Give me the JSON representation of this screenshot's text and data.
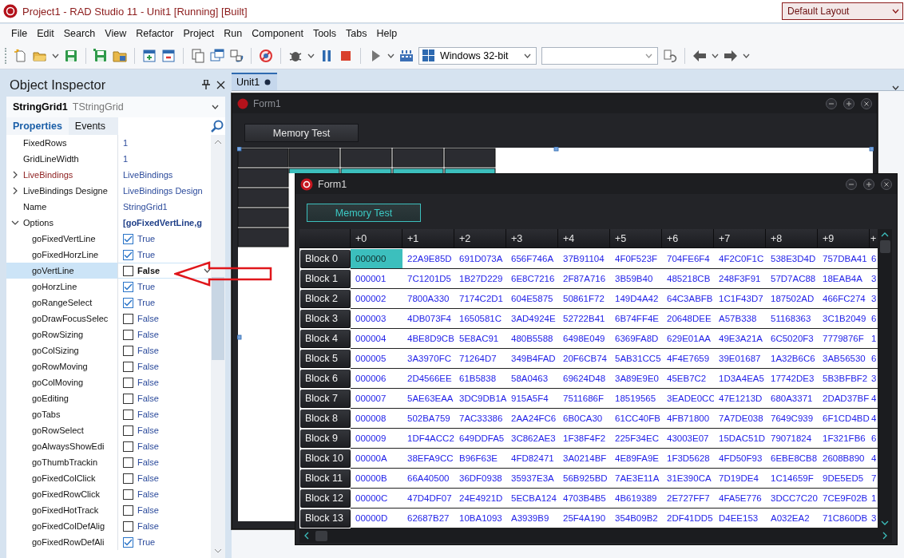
{
  "window": {
    "title": "Project1 - RAD Studio 11 - Unit1 [Running] [Built]",
    "layout": "Default Layout"
  },
  "menu": [
    "File",
    "Edit",
    "Search",
    "View",
    "Refactor",
    "Project",
    "Run",
    "Component",
    "Tools",
    "Tabs",
    "Help"
  ],
  "toolbar": {
    "platform": "Windows 32-bit"
  },
  "inspector": {
    "title": "Object Inspector",
    "component": {
      "name": "StringGrid1",
      "type": "TStringGrid"
    },
    "tabs": [
      {
        "label": "Properties",
        "selected": true
      },
      {
        "label": "Events",
        "selected": false
      }
    ],
    "properties": [
      {
        "name": "FixedRows",
        "value": "1",
        "kind": "plain",
        "selected": false
      },
      {
        "name": "GridLineWidth",
        "value": "1",
        "kind": "plain",
        "selected": false
      },
      {
        "name": "LiveBindings",
        "value": "LiveBindings",
        "kind": "binding",
        "expanded": false,
        "selected": false
      },
      {
        "name": "LiveBindings Designe",
        "value": "LiveBindings Design",
        "kind": "plain",
        "expanded": false,
        "selected": false
      },
      {
        "name": "Name",
        "value": "StringGrid1",
        "kind": "plain",
        "selected": false
      },
      {
        "name": "Options",
        "value": "[goFixedVertLine,g",
        "kind": "set",
        "expanded": true,
        "selected": false,
        "children": [
          {
            "name": "goFixedVertLine",
            "value": "True",
            "kind": "flag",
            "checked": true,
            "selected": false
          },
          {
            "name": "goFixedHorzLine",
            "value": "True",
            "kind": "flag",
            "checked": true,
            "selected": false
          },
          {
            "name": "goVertLine",
            "value": "False",
            "kind": "flag",
            "checked": false,
            "selected": true
          },
          {
            "name": "goHorzLine",
            "value": "True",
            "kind": "flag",
            "checked": true,
            "selected": false
          },
          {
            "name": "goRangeSelect",
            "value": "True",
            "kind": "flag",
            "checked": true,
            "selected": false
          },
          {
            "name": "goDrawFocusSelec",
            "value": "False",
            "kind": "flag",
            "checked": false,
            "selected": false
          },
          {
            "name": "goRowSizing",
            "value": "False",
            "kind": "flag",
            "checked": false,
            "selected": false
          },
          {
            "name": "goColSizing",
            "value": "False",
            "kind": "flag",
            "checked": false,
            "selected": false
          },
          {
            "name": "goRowMoving",
            "value": "False",
            "kind": "flag",
            "checked": false,
            "selected": false
          },
          {
            "name": "goColMoving",
            "value": "False",
            "kind": "flag",
            "checked": false,
            "selected": false
          },
          {
            "name": "goEditing",
            "value": "False",
            "kind": "flag",
            "checked": false,
            "selected": false
          },
          {
            "name": "goTabs",
            "value": "False",
            "kind": "flag",
            "checked": false,
            "selected": false
          },
          {
            "name": "goRowSelect",
            "value": "False",
            "kind": "flag",
            "checked": false,
            "selected": false
          },
          {
            "name": "goAlwaysShowEdi",
            "value": "False",
            "kind": "flag",
            "checked": false,
            "selected": false
          },
          {
            "name": "goThumbTrackin",
            "value": "False",
            "kind": "flag",
            "checked": false,
            "selected": false
          },
          {
            "name": "goFixedColClick",
            "value": "False",
            "kind": "flag",
            "checked": false,
            "selected": false
          },
          {
            "name": "goFixedRowClick",
            "value": "False",
            "kind": "flag",
            "checked": false,
            "selected": false
          },
          {
            "name": "goFixedHotTrack",
            "value": "False",
            "kind": "flag",
            "checked": false,
            "selected": false
          },
          {
            "name": "goFixedColDefAlig",
            "value": "False",
            "kind": "flag",
            "checked": false,
            "selected": false
          },
          {
            "name": "goFixedRowDefAli",
            "value": "True",
            "kind": "flag",
            "checked": true,
            "selected": false
          }
        ]
      }
    ]
  },
  "editor_tab": {
    "label": "Unit1",
    "modified": true
  },
  "design_form": {
    "title": "Form1",
    "button": "Memory Test"
  },
  "form": {
    "title": "Form1",
    "button": "Memory Test",
    "grid": {
      "columns": [
        "+0",
        "+1",
        "+2",
        "+3",
        "+4",
        "+5",
        "+6",
        "+7",
        "+8",
        "+9",
        "+"
      ],
      "rows": [
        {
          "header": "Block 0",
          "cells": [
            {
              "text": "000000",
              "selected": true
            },
            {
              "text": "22A9E85D",
              "selected": false
            },
            {
              "text": "691D073A",
              "selected": false
            },
            {
              "text": "656F746A",
              "selected": false
            },
            {
              "text": "37B91104",
              "selected": false
            },
            {
              "text": "4F0F523F",
              "selected": false
            },
            {
              "text": "704FE6F4",
              "selected": false
            },
            {
              "text": "4F2C0F1C",
              "selected": false
            },
            {
              "text": "538E3D4D",
              "selected": false
            },
            {
              "text": "757DBA41",
              "selected": false
            },
            {
              "text": "6",
              "selected": false
            }
          ]
        },
        {
          "header": "Block 1",
          "cells": [
            {
              "text": "000001",
              "selected": false
            },
            {
              "text": "7C1201D5",
              "selected": false
            },
            {
              "text": "1B27D229",
              "selected": false
            },
            {
              "text": "6E8C7216",
              "selected": false
            },
            {
              "text": "2F87A716",
              "selected": false
            },
            {
              "text": "3B59B40",
              "selected": false
            },
            {
              "text": "485218CB",
              "selected": false
            },
            {
              "text": "248F3F91",
              "selected": false
            },
            {
              "text": "57D7AC88",
              "selected": false
            },
            {
              "text": "18EAB4A",
              "selected": false
            },
            {
              "text": "3",
              "selected": false
            }
          ]
        },
        {
          "header": "Block 2",
          "cells": [
            {
              "text": "000002",
              "selected": false
            },
            {
              "text": "7800A330",
              "selected": false
            },
            {
              "text": "7174C2D1",
              "selected": false
            },
            {
              "text": "604E5875",
              "selected": false
            },
            {
              "text": "50861F72",
              "selected": false
            },
            {
              "text": "149D4A42",
              "selected": false
            },
            {
              "text": "64C3ABFB",
              "selected": false
            },
            {
              "text": "1C1F43D7",
              "selected": false
            },
            {
              "text": "187502AD",
              "selected": false
            },
            {
              "text": "466FC274",
              "selected": false
            },
            {
              "text": "3",
              "selected": false
            }
          ]
        },
        {
          "header": "Block 3",
          "cells": [
            {
              "text": "000003",
              "selected": false
            },
            {
              "text": "4DB073F4",
              "selected": false
            },
            {
              "text": "1650581C",
              "selected": false
            },
            {
              "text": "3AD4924E",
              "selected": false
            },
            {
              "text": "52722B41",
              "selected": false
            },
            {
              "text": "6B74FF4E",
              "selected": false
            },
            {
              "text": "20648DEE",
              "selected": false
            },
            {
              "text": "A57B338",
              "selected": false
            },
            {
              "text": "51168363",
              "selected": false
            },
            {
              "text": "3C1B2049",
              "selected": false
            },
            {
              "text": "6",
              "selected": false
            }
          ]
        },
        {
          "header": "Block 4",
          "cells": [
            {
              "text": "000004",
              "selected": false
            },
            {
              "text": "4BE8D9CB",
              "selected": false
            },
            {
              "text": "5E8AC91",
              "selected": false
            },
            {
              "text": "480B5588",
              "selected": false
            },
            {
              "text": "6498E049",
              "selected": false
            },
            {
              "text": "6369FA8D",
              "selected": false
            },
            {
              "text": "629E01AA",
              "selected": false
            },
            {
              "text": "49E3A21A",
              "selected": false
            },
            {
              "text": "6C5020F3",
              "selected": false
            },
            {
              "text": "7779876F",
              "selected": false
            },
            {
              "text": "1",
              "selected": false
            }
          ]
        },
        {
          "header": "Block 5",
          "cells": [
            {
              "text": "000005",
              "selected": false
            },
            {
              "text": "3A3970FC",
              "selected": false
            },
            {
              "text": "71264D7",
              "selected": false
            },
            {
              "text": "349B4FAD",
              "selected": false
            },
            {
              "text": "20F6CB74",
              "selected": false
            },
            {
              "text": "5AB31CC5",
              "selected": false
            },
            {
              "text": "4F4E7659",
              "selected": false
            },
            {
              "text": "39E01687",
              "selected": false
            },
            {
              "text": "1A32B6C6",
              "selected": false
            },
            {
              "text": "3AB56530",
              "selected": false
            },
            {
              "text": "6",
              "selected": false
            }
          ]
        },
        {
          "header": "Block 6",
          "cells": [
            {
              "text": "000006",
              "selected": false
            },
            {
              "text": "2D4566EE",
              "selected": false
            },
            {
              "text": "61B5838",
              "selected": false
            },
            {
              "text": "58A0463",
              "selected": false
            },
            {
              "text": "69624D48",
              "selected": false
            },
            {
              "text": "3A89E9E0",
              "selected": false
            },
            {
              "text": "45EB7C2",
              "selected": false
            },
            {
              "text": "1D3A4EA5",
              "selected": false
            },
            {
              "text": "17742DE3",
              "selected": false
            },
            {
              "text": "5B3BFBF2",
              "selected": false
            },
            {
              "text": "3",
              "selected": false
            }
          ]
        },
        {
          "header": "Block 7",
          "cells": [
            {
              "text": "000007",
              "selected": false
            },
            {
              "text": "5AE63EAA",
              "selected": false
            },
            {
              "text": "3DC9DB1A",
              "selected": false
            },
            {
              "text": "915A5F4",
              "selected": false
            },
            {
              "text": "7511686F",
              "selected": false
            },
            {
              "text": "18519565",
              "selected": false
            },
            {
              "text": "3EADE0CC",
              "selected": false
            },
            {
              "text": "47E1213D",
              "selected": false
            },
            {
              "text": "680A3371",
              "selected": false
            },
            {
              "text": "2DAD37BF",
              "selected": false
            },
            {
              "text": "4",
              "selected": false
            }
          ]
        },
        {
          "header": "Block 8",
          "cells": [
            {
              "text": "000008",
              "selected": false
            },
            {
              "text": "502BA759",
              "selected": false
            },
            {
              "text": "7AC33386",
              "selected": false
            },
            {
              "text": "2AA24FC6",
              "selected": false
            },
            {
              "text": "6B0CA30",
              "selected": false
            },
            {
              "text": "61CC40FB",
              "selected": false
            },
            {
              "text": "4FB71800",
              "selected": false
            },
            {
              "text": "7A7DE038",
              "selected": false
            },
            {
              "text": "7649C939",
              "selected": false
            },
            {
              "text": "6F1CD4BD",
              "selected": false
            },
            {
              "text": "4",
              "selected": false
            }
          ]
        },
        {
          "header": "Block 9",
          "cells": [
            {
              "text": "000009",
              "selected": false
            },
            {
              "text": "1DF4ACC2",
              "selected": false
            },
            {
              "text": "649DDFA5",
              "selected": false
            },
            {
              "text": "3C862AE3",
              "selected": false
            },
            {
              "text": "1F38F4F2",
              "selected": false
            },
            {
              "text": "225F34EC",
              "selected": false
            },
            {
              "text": "43003E07",
              "selected": false
            },
            {
              "text": "15DAC51D",
              "selected": false
            },
            {
              "text": "79071824",
              "selected": false
            },
            {
              "text": "1F321FB6",
              "selected": false
            },
            {
              "text": "6",
              "selected": false
            }
          ]
        },
        {
          "header": "Block 10",
          "cells": [
            {
              "text": "00000A",
              "selected": false
            },
            {
              "text": "38EFA9CC",
              "selected": false
            },
            {
              "text": "B96F63E",
              "selected": false
            },
            {
              "text": "4FD82471",
              "selected": false
            },
            {
              "text": "3A0214BF",
              "selected": false
            },
            {
              "text": "4E89FA9E",
              "selected": false
            },
            {
              "text": "1F3D5628",
              "selected": false
            },
            {
              "text": "4FD50F93",
              "selected": false
            },
            {
              "text": "6EBE8CB8",
              "selected": false
            },
            {
              "text": "2608B890",
              "selected": false
            },
            {
              "text": "4",
              "selected": false
            }
          ]
        },
        {
          "header": "Block 11",
          "cells": [
            {
              "text": "00000B",
              "selected": false
            },
            {
              "text": "66A40500",
              "selected": false
            },
            {
              "text": "36DF0938",
              "selected": false
            },
            {
              "text": "35937E3A",
              "selected": false
            },
            {
              "text": "56B925BD",
              "selected": false
            },
            {
              "text": "7AE3E11A",
              "selected": false
            },
            {
              "text": "31E390CA",
              "selected": false
            },
            {
              "text": "7D19DE4",
              "selected": false
            },
            {
              "text": "1C14659F",
              "selected": false
            },
            {
              "text": "9DE5ED5",
              "selected": false
            },
            {
              "text": "7",
              "selected": false
            }
          ]
        },
        {
          "header": "Block 12",
          "cells": [
            {
              "text": "00000C",
              "selected": false
            },
            {
              "text": "47D4DF07",
              "selected": false
            },
            {
              "text": "24E4921D",
              "selected": false
            },
            {
              "text": "5ECBA124",
              "selected": false
            },
            {
              "text": "4703B4B5",
              "selected": false
            },
            {
              "text": "4B619389",
              "selected": false
            },
            {
              "text": "2E727FF7",
              "selected": false
            },
            {
              "text": "4FA5E776",
              "selected": false
            },
            {
              "text": "3DCC7C20",
              "selected": false
            },
            {
              "text": "7CE9F02B",
              "selected": false
            },
            {
              "text": "1",
              "selected": false
            }
          ]
        },
        {
          "header": "Block 13",
          "cells": [
            {
              "text": "00000D",
              "selected": false
            },
            {
              "text": "62687B27",
              "selected": false
            },
            {
              "text": "10BA1093",
              "selected": false
            },
            {
              "text": "A3939B9",
              "selected": false
            },
            {
              "text": "25F4A190",
              "selected": false
            },
            {
              "text": "354B09B2",
              "selected": false
            },
            {
              "text": "2DF41DD5",
              "selected": false
            },
            {
              "text": "D4EE153",
              "selected": false
            },
            {
              "text": "A032EA2",
              "selected": false
            },
            {
              "text": "71C860DB",
              "selected": false
            },
            {
              "text": "3",
              "selected": false
            }
          ]
        }
      ]
    }
  }
}
